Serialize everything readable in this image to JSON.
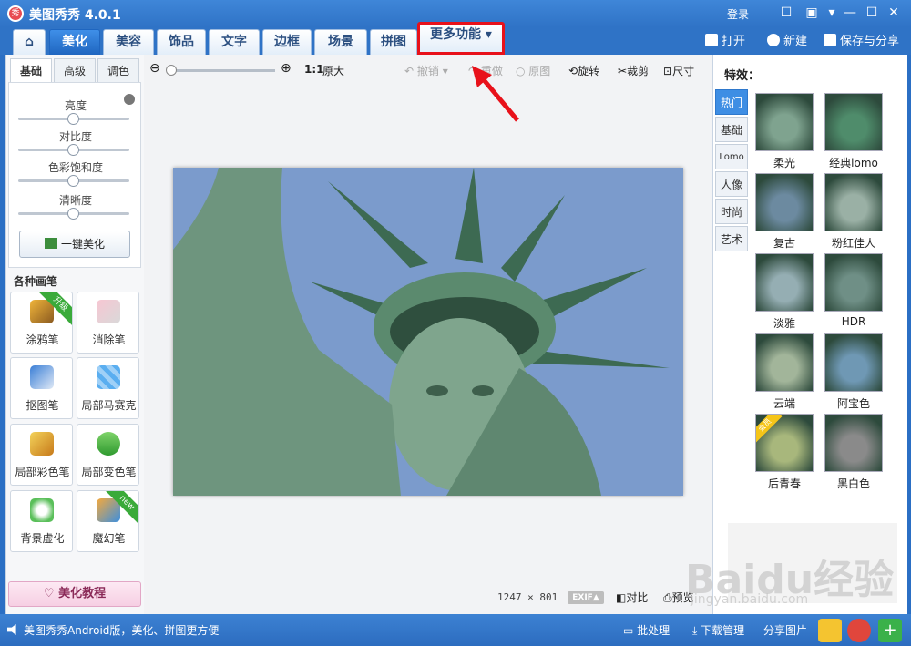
{
  "app": {
    "title": "美图秀秀 4.0.1",
    "logo_text": "秀",
    "login": "登录"
  },
  "tabs": [
    {
      "label": "美化"
    },
    {
      "label": "美容"
    },
    {
      "label": "饰品"
    },
    {
      "label": "文字"
    },
    {
      "label": "边框"
    },
    {
      "label": "场景"
    },
    {
      "label": "拼图"
    },
    {
      "label": "更多功能 ▾"
    }
  ],
  "top_actions": {
    "open": "打开",
    "new": "新建",
    "save": "保存与分享"
  },
  "left": {
    "subtabs": [
      "基础",
      "高级",
      "调色"
    ],
    "adjustments": [
      {
        "label": "亮度",
        "value": 0.5
      },
      {
        "label": "对比度",
        "value": 0.5
      },
      {
        "label": "色彩饱和度",
        "value": 0.5
      },
      {
        "label": "清晰度",
        "value": 0.5
      }
    ],
    "onekey": "一键美化",
    "brushes_title": "各种画笔",
    "brushes": [
      {
        "label": "涂鸦笔",
        "badge": "升级"
      },
      {
        "label": "消除笔",
        "badge": ""
      },
      {
        "label": "抠图笔",
        "badge": ""
      },
      {
        "label": "局部马赛克",
        "badge": ""
      },
      {
        "label": "局部彩色笔",
        "badge": ""
      },
      {
        "label": "局部变色笔",
        "badge": ""
      },
      {
        "label": "背景虚化",
        "badge": ""
      },
      {
        "label": "魔幻笔",
        "badge": "new"
      }
    ],
    "tutorial": "美化教程"
  },
  "toolbar": {
    "zoom_ratio": "1:1",
    "original_size": "原大",
    "undo": "撤销",
    "redo": "重做",
    "original": "原图",
    "rotate": "旋转",
    "crop": "裁剪",
    "size": "尺寸"
  },
  "image_info": {
    "dims": "1247 × 801",
    "exif": "EXIF▲",
    "compare": "对比",
    "preview": "预览"
  },
  "right": {
    "title": "特效：",
    "tabs": [
      "热门",
      "基础",
      "Lomo",
      "人像",
      "时尚",
      "艺术"
    ],
    "effects": [
      {
        "label": "柔光",
        "tint": "#7fa38f"
      },
      {
        "label": "经典lomo",
        "tint": "#4f8c6b"
      },
      {
        "label": "复古",
        "tint": "#6c8aa0"
      },
      {
        "label": "粉红佳人",
        "tint": "#9ab0a5"
      },
      {
        "label": "淡雅",
        "tint": "#95aeb3"
      },
      {
        "label": "HDR",
        "tint": "#6f8f86"
      },
      {
        "label": "云端",
        "tint": "#a2b59a"
      },
      {
        "label": "阿宝色",
        "tint": "#6f98b4"
      },
      {
        "label": "后青春",
        "tint": "#a8b77c"
      },
      {
        "label": "黑白色",
        "tint": "#8a8a8a"
      }
    ],
    "badge_vip": "会员"
  },
  "status": {
    "message": "美图秀秀Android版，美化、拼图更方便",
    "batch": "批处理",
    "downloads": "下载管理",
    "share": "分享图片"
  },
  "watermark": {
    "text": "Baidu经验",
    "url": "jingyan.baidu.com"
  },
  "colors": {
    "accent": "#2f73c6",
    "highlight": "#e8111a"
  }
}
